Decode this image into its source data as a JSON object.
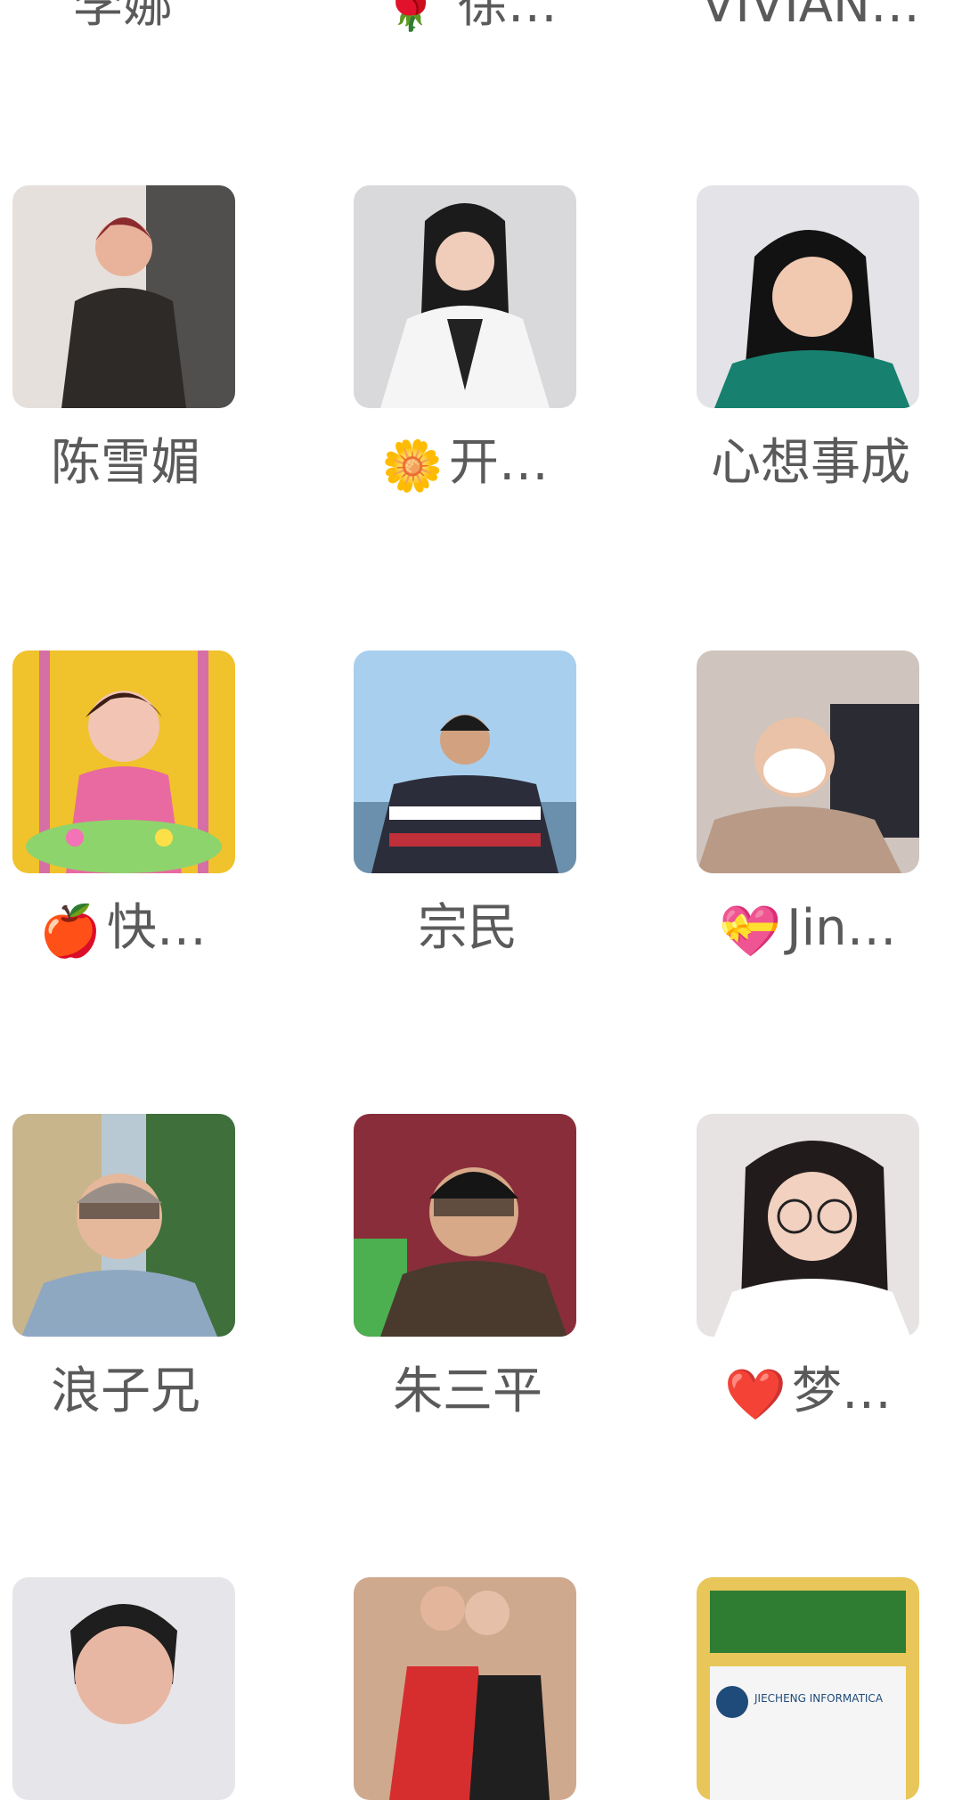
{
  "top_row": [
    "李娜",
    "🌹 徐…",
    "VIVIAN…"
  ],
  "rows": [
    [
      {
        "name": "陈雪媚",
        "emoji": ""
      },
      {
        "name": "开…",
        "emoji": "🌼"
      },
      {
        "name": "心想事成",
        "emoji": ""
      }
    ],
    [
      {
        "name": "快…",
        "emoji": "🍎"
      },
      {
        "name": "宗民",
        "emoji": ""
      },
      {
        "name": "Jin…",
        "emoji": "💝"
      }
    ],
    [
      {
        "name": "浪子兄",
        "emoji": ""
      },
      {
        "name": "朱三平",
        "emoji": ""
      },
      {
        "name": "梦…",
        "emoji": "❤️"
      }
    ]
  ],
  "avatar_icons": {
    "r1c1": "person-avatar",
    "r1c2": "person-avatar",
    "r1c3": "person-avatar",
    "r2c1": "person-avatar",
    "r2c2": "person-avatar",
    "r2c3": "person-avatar",
    "r3c1": "person-avatar",
    "r3c2": "person-avatar",
    "r3c3": "person-avatar",
    "r4c1": "person-avatar",
    "r4c2": "person-avatar",
    "r4c3": "sign-avatar"
  },
  "r4_sign_text": "JIECHENG INFORMATICA"
}
